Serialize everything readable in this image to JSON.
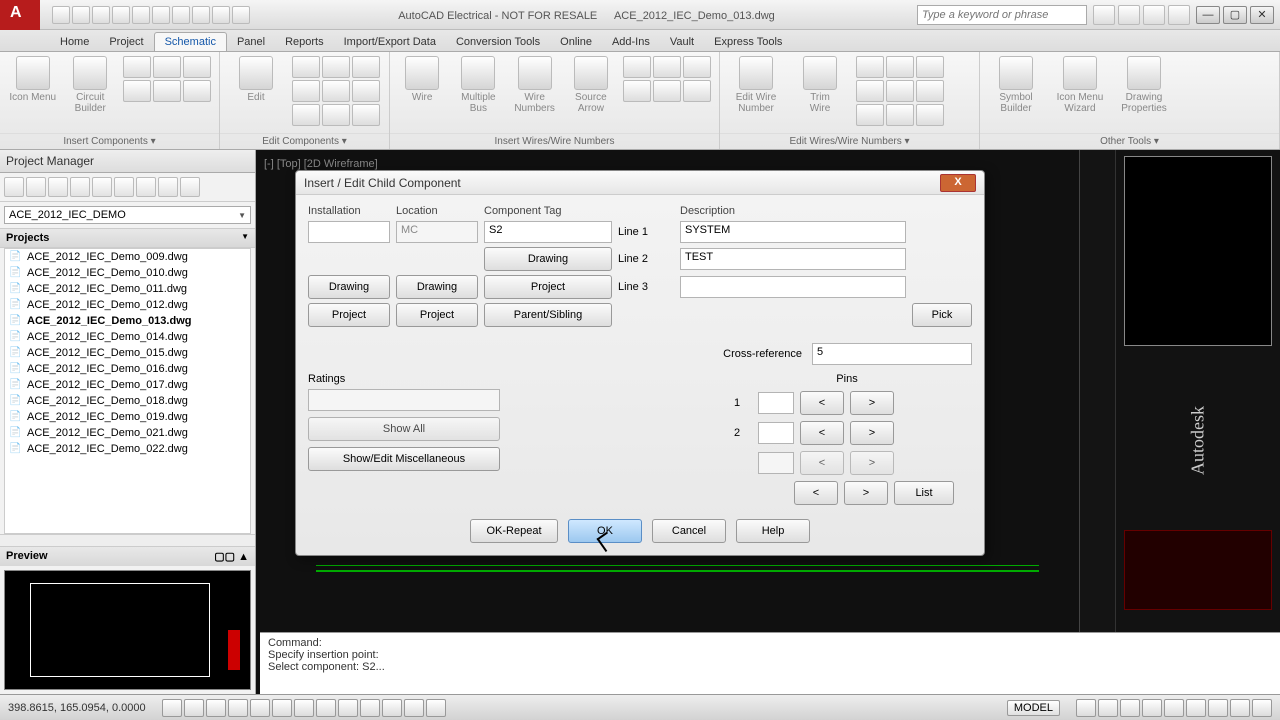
{
  "title": {
    "app": "AutoCAD Electrical - NOT FOR RESALE",
    "file": "ACE_2012_IEC_Demo_013.dwg",
    "search_placeholder": "Type a keyword or phrase"
  },
  "tabs": [
    "Home",
    "Project",
    "Schematic",
    "Panel",
    "Reports",
    "Import/Export Data",
    "Conversion Tools",
    "Online",
    "Add-Ins",
    "Vault",
    "Express Tools"
  ],
  "active_tab": "Schematic",
  "ribbon": {
    "panels": [
      {
        "label": "Insert Components ▾",
        "big": [
          {
            "l": "Icon Menu"
          },
          {
            "l": "Circuit Builder"
          }
        ],
        "grid": 6
      },
      {
        "label": "Edit Components ▾",
        "big": [
          {
            "l": "Edit"
          }
        ],
        "grid": 9
      },
      {
        "label": "Insert Wires/Wire Numbers",
        "big": [
          {
            "l": "Wire"
          },
          {
            "l": "Multiple\nBus"
          },
          {
            "l": "Wire\nNumbers"
          },
          {
            "l": "Source\nArrow"
          }
        ],
        "grid": 9
      },
      {
        "label": "Edit Wires/Wire Numbers ▾",
        "big": [
          {
            "l": "Edit Wire\nNumber"
          },
          {
            "l": "Trim\nWire"
          }
        ],
        "grid": 9
      },
      {
        "label": "Other Tools ▾",
        "big": [
          {
            "l": "Symbol Builder"
          },
          {
            "l": "Icon Menu\nWizard"
          },
          {
            "l": "Drawing\nProperties"
          }
        ],
        "grid": 0
      }
    ]
  },
  "project_manager": {
    "title": "Project Manager",
    "combo": "ACE_2012_IEC_DEMO",
    "section": "Projects",
    "files": [
      "ACE_2012_IEC_Demo_009.dwg",
      "ACE_2012_IEC_Demo_010.dwg",
      "ACE_2012_IEC_Demo_011.dwg",
      "ACE_2012_IEC_Demo_012.dwg",
      "ACE_2012_IEC_Demo_013.dwg",
      "ACE_2012_IEC_Demo_014.dwg",
      "ACE_2012_IEC_Demo_015.dwg",
      "ACE_2012_IEC_Demo_016.dwg",
      "ACE_2012_IEC_Demo_017.dwg",
      "ACE_2012_IEC_Demo_018.dwg",
      "ACE_2012_IEC_Demo_019.dwg",
      "ACE_2012_IEC_Demo_021.dwg",
      "ACE_2012_IEC_Demo_022.dwg"
    ],
    "active_file": "ACE_2012_IEC_Demo_013.dwg",
    "preview": "Preview"
  },
  "canvas": {
    "wireframe": "[-] [Top] [2D Wireframe]"
  },
  "dialog": {
    "title": "Insert / Edit Child Component",
    "headers": {
      "installation": "Installation",
      "location": "Location",
      "tag": "Component Tag",
      "description": "Description"
    },
    "installation_val": "",
    "location_val": "MC",
    "tag_val": "S2",
    "line1": "Line 1",
    "line1_val": "SYSTEM",
    "line2": "Line 2",
    "line2_val": "TEST",
    "line3": "Line 3",
    "line3_val": "",
    "btn_drawing": "Drawing",
    "btn_project": "Project",
    "btn_parent": "Parent/Sibling",
    "btn_pick": "Pick",
    "crossref": "Cross-reference",
    "crossref_val": "5",
    "ratings": "Ratings",
    "show_all": "Show All",
    "show_edit": "Show/Edit Miscellaneous",
    "pins": "Pins",
    "pin1": "1",
    "pin2": "2",
    "lt": "<",
    "gt": ">",
    "list": "List",
    "ok_repeat": "OK-Repeat",
    "ok": "OK",
    "cancel": "Cancel",
    "help": "Help"
  },
  "cmd": {
    "l1": "Command:",
    "l2": "Specify insertion point:",
    "l3": "Select component: S2..."
  },
  "status": {
    "coords": "398.8615, 165.0954, 0.0000",
    "model": "MODEL"
  }
}
